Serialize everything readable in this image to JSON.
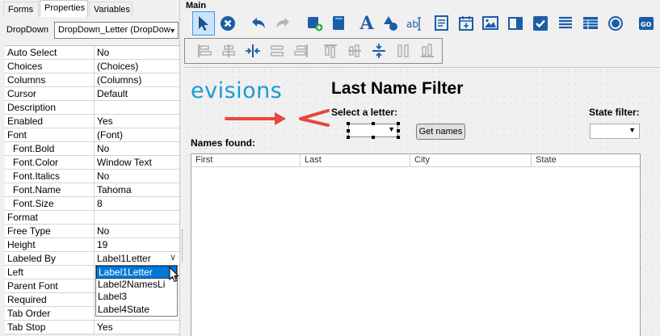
{
  "left_panel": {
    "tabs": [
      "Forms",
      "Properties",
      "Variables"
    ],
    "object_label": "DropDown",
    "object_select_value": "DropDown_Letter (DropDow",
    "properties": [
      {
        "name": "Auto Select",
        "value": "No"
      },
      {
        "name": "Choices",
        "value": "(Choices)"
      },
      {
        "name": "Columns",
        "value": "(Columns)"
      },
      {
        "name": "Cursor",
        "value": "Default"
      },
      {
        "name": "Description",
        "value": ""
      },
      {
        "name": "Enabled",
        "value": "Yes"
      },
      {
        "name": "Font",
        "value": "(Font)"
      },
      {
        "name": "Font.Bold",
        "value": "No"
      },
      {
        "name": "Font.Color",
        "value": "Window Text"
      },
      {
        "name": "Font.Italics",
        "value": "No"
      },
      {
        "name": "Font.Name",
        "value": "Tahoma"
      },
      {
        "name": "Font.Size",
        "value": "8"
      },
      {
        "name": "Format",
        "value": ""
      },
      {
        "name": "Free Type",
        "value": "No"
      },
      {
        "name": "Height",
        "value": "19"
      },
      {
        "name": "Labeled By",
        "value": "Label1Letter"
      },
      {
        "name": "Left",
        "value": ""
      },
      {
        "name": "Parent Font",
        "value": ""
      },
      {
        "name": "Required",
        "value": ""
      },
      {
        "name": "Tab Order",
        "value": ""
      },
      {
        "name": "Tab Stop",
        "value": "Yes"
      }
    ],
    "labeled_by_options": [
      "Label1Letter",
      "Label2NamesLi",
      "Label3",
      "Label4State"
    ],
    "labeled_by_selected": "Label1Letter"
  },
  "toolbar": {
    "title": "Main"
  },
  "canvas": {
    "logo_text": "evisions",
    "title": "Last Name Filter",
    "select_letter_label": "Select a letter:",
    "state_filter_label": "State filter:",
    "get_names_button": "Get names",
    "names_found_label": "Names found:",
    "table_columns": [
      "First",
      "Last",
      "City",
      "State"
    ],
    "arrow_color": "#e8473f",
    "logo_color": "#1a9ad6"
  }
}
